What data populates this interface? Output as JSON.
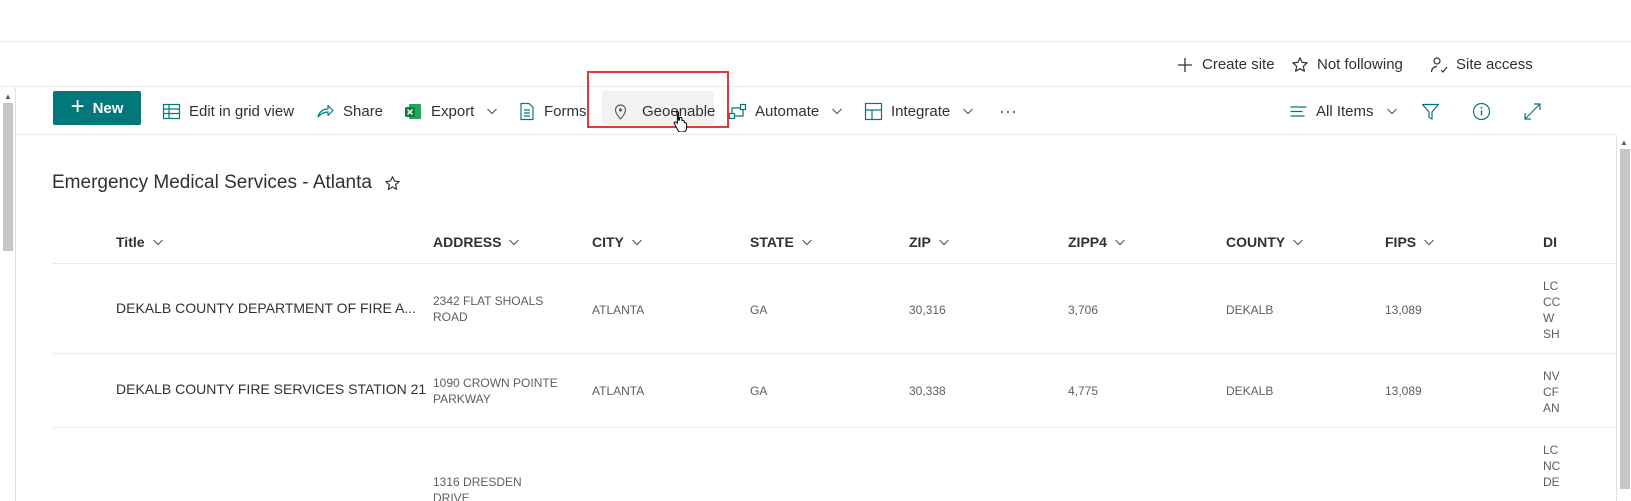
{
  "site_bar": {
    "create_site": "Create site",
    "not_following": "Not following",
    "site_access": "Site access"
  },
  "command_bar": {
    "new": "New",
    "edit_grid": "Edit in grid view",
    "share": "Share",
    "export": "Export",
    "forms": "Forms",
    "geoenable": "Geoenable",
    "automate": "Automate",
    "integrate": "Integrate",
    "more": "···",
    "view": "All Items",
    "accent": "#03787c",
    "highlight": "#e0393e"
  },
  "list": {
    "title": "Emergency Medical Services - Atlanta",
    "columns": [
      "Title",
      "ADDRESS",
      "CITY",
      "STATE",
      "ZIP",
      "ZIPP4",
      "COUNTY",
      "FIPS",
      "DI"
    ],
    "rows": [
      {
        "title": "DEKALB COUNTY DEPARTMENT OF FIRE A...",
        "address": "2342 FLAT SHOALS ROAD",
        "city": "ATLANTA",
        "state": "GA",
        "zip": "30,316",
        "zipp4": "3,706",
        "county": "DEKALB",
        "fips": "13,089",
        "di": "LC\nCC\nW\nSH"
      },
      {
        "title": "DEKALB COUNTY FIRE SERVICES STATION 21",
        "address": "1090 CROWN POINTE PARKWAY",
        "city": "ATLANTA",
        "state": "GA",
        "zip": "30,338",
        "zipp4": "4,775",
        "county": "DEKALB",
        "fips": "13,089",
        "di": "NV\nCF\nAN"
      },
      {
        "title": "",
        "address": "1316 DRESDEN DRIVE",
        "city": "",
        "state": "",
        "zip": "",
        "zipp4": "",
        "county": "",
        "fips": "",
        "di": "LC\nNC\nDE"
      }
    ]
  }
}
